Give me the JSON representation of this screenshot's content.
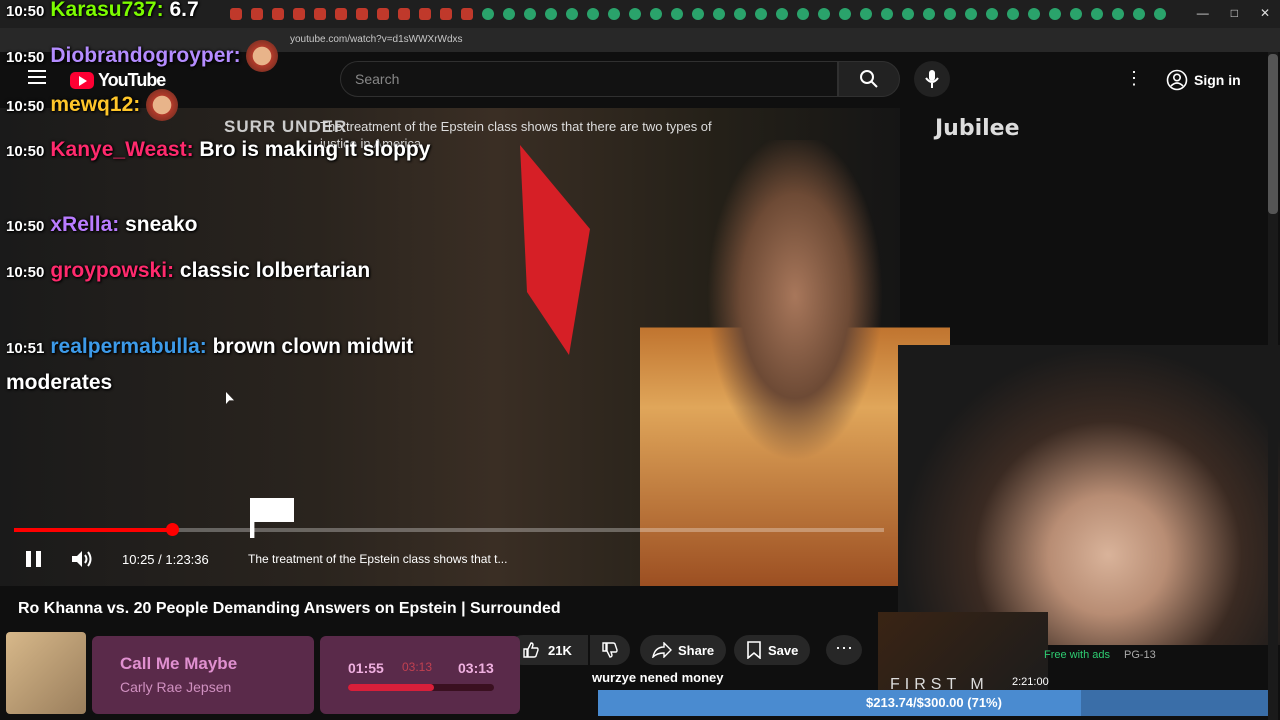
{
  "browser": {
    "url": "youtube.com/watch?v=d1sWWXrWdxs"
  },
  "youtube": {
    "logo_text": "YouTube",
    "search_placeholder": "Search",
    "signin_label": "Sign in"
  },
  "video": {
    "overlay_brand": "SURR UNDER",
    "overlay_caption": "The treatment of the Epstein class shows that there are two types of justice in America",
    "watermark": "Jubilee",
    "time_current": "10:25",
    "time_total": "1:23:36",
    "time_display": "10:25 / 1:23:36",
    "chapter_title": "The treatment of the Epstein class shows that t...",
    "progress_fraction": 0.18
  },
  "page": {
    "title": "Ro Khanna vs. 20 People Demanding Answers on Epstein | Surrounded",
    "likes": "21K",
    "share_label": "Share",
    "save_label": "Save"
  },
  "chat": [
    {
      "time": "10:50",
      "user": "Karasu737",
      "color": "#7cfc00",
      "text": "6.7"
    },
    {
      "time": "10:50",
      "user": "Diobrandogroyper",
      "color": "#b48cff",
      "text": ""
    },
    {
      "time": "10:50",
      "user": "mewq12",
      "color": "#ffc62a",
      "text": ""
    },
    {
      "time": "10:50",
      "user": "Kanye_Weast",
      "color": "#ff2a6d",
      "text": "Bro is making it sloppy"
    },
    {
      "time": "10:50",
      "user": "xRella",
      "color": "#b97cff",
      "text": "sneako"
    },
    {
      "time": "10:50",
      "user": "groypowski",
      "color": "#ff2a6d",
      "text": "classic lolbertarian"
    },
    {
      "time": "10:51",
      "user": "realpermabulla",
      "color": "#3d9ae8",
      "text": "brown clown midwit moderates"
    }
  ],
  "music": {
    "title": "Call Me Maybe",
    "artist": "Carly Rae Jepsen",
    "elapsed": "01:55",
    "remaining": "03:13",
    "mid": "03:13",
    "progress_fraction": 0.59
  },
  "sidebar": {
    "free_with_ads": "Free with ads",
    "rating": "PG-13",
    "duration": "2:21:00",
    "movie_title": "FIRST M"
  },
  "donation": {
    "message": "wurzye nened money",
    "goal_text": "$213.74/$300.00 (71%)",
    "progress_fraction": 0.71
  },
  "colors": {
    "accent": "#ff0000",
    "youtube_red": "#ff0033"
  }
}
